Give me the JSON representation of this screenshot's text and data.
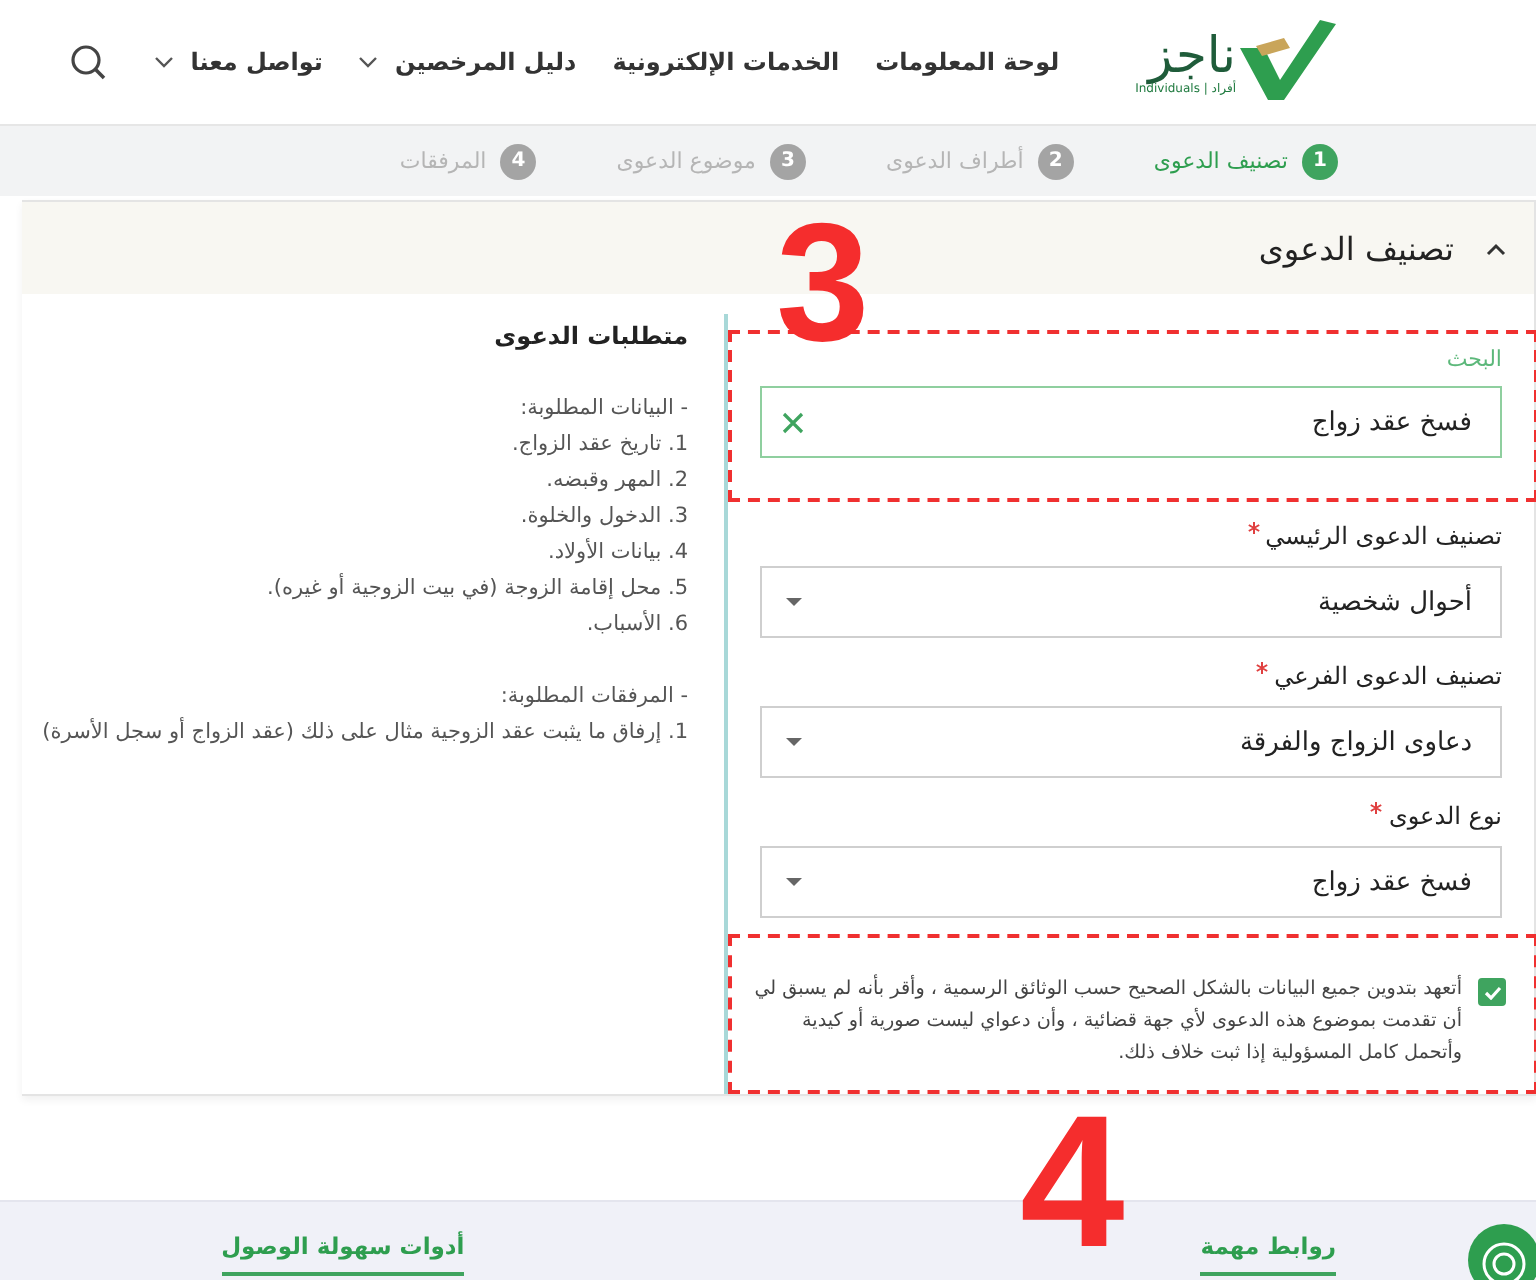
{
  "header": {
    "logo": {
      "text": "ناجز",
      "subtitle": "أفراد | Individuals"
    },
    "nav": [
      {
        "label": "لوحة المعلومات",
        "dropdown": false
      },
      {
        "label": "الخدمات الإلكترونية",
        "dropdown": false
      },
      {
        "label": "دليل المرخصين",
        "dropdown": true
      },
      {
        "label": "تواصل معنا",
        "dropdown": true
      }
    ]
  },
  "steps": [
    {
      "number": "1",
      "label": "تصنيف الدعوى",
      "selected": true
    },
    {
      "number": "2",
      "label": "أطراف الدعوى",
      "selected": false
    },
    {
      "number": "3",
      "label": "موضوع الدعوى",
      "selected": false
    },
    {
      "number": "4",
      "label": "المرفقات",
      "selected": false
    }
  ],
  "section": {
    "title": "تصنيف الدعوى",
    "expanded": true,
    "requirements": {
      "title": "متطلبات الدعوى",
      "groups": [
        {
          "lines": [
            "- البيانات المطلوبة:",
            "1. تاريخ عقد الزواج.",
            "2. المهر وقبضه.",
            "3. الدخول والخلوة.",
            "4. بيانات الأولاد.",
            "5. محل إقامة الزوجة (في بيت الزوجية أو غيره).",
            "6. الأسباب."
          ]
        },
        {
          "lines": [
            "- المرفقات المطلوبة:",
            "1. إرفاق ما يثبت عقد الزوجية مثال على ذلك (عقد الزواج أو سجل الأسرة)"
          ]
        }
      ]
    },
    "search": {
      "label": "البحث",
      "value": "فسخ عقد زواج",
      "highlighted": true
    },
    "fields": [
      {
        "label": "تصنيف الدعوى الرئيسي",
        "required": true,
        "value": "أحوال شخصية"
      },
      {
        "label": "تصنيف الدعوى الفرعي",
        "required": true,
        "value": "دعاوى الزواج والفرقة"
      },
      {
        "label": "نوع الدعوى",
        "required": true,
        "value": "فسخ عقد زواج"
      }
    ],
    "pledge": {
      "checked": true,
      "highlighted": true,
      "text": "أتعهد بتدوين جميع البيانات بالشكل الصحيح حسب الوثائق الرسمية ، وأقر بأنه لم يسبق لي أن تقدمت بموضوع هذه الدعوى لأي جهة قضائية ، وأن دعواي ليست صورية أو كيدية وأتحمل كامل المسؤولية إذا ثبت خلاف ذلك."
    }
  },
  "footer": {
    "links": [
      {
        "label": "روابط مهمة"
      },
      {
        "label": "أدوات سهولة الوصول"
      }
    ]
  },
  "annotations": [
    {
      "text": "3"
    },
    {
      "text": "4"
    }
  ]
}
